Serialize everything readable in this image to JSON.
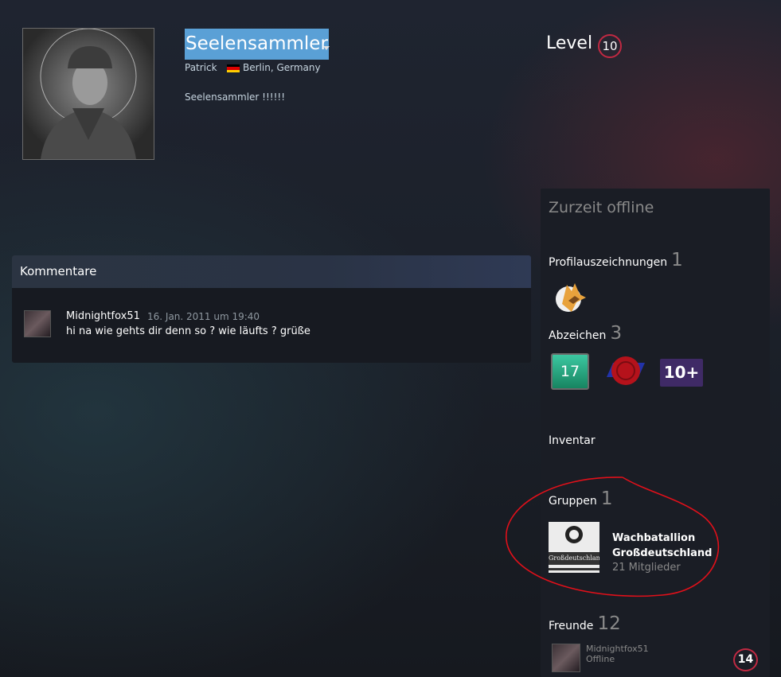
{
  "profile": {
    "persona_name": "Seelensammler",
    "real_name": "Patrick",
    "location": "Berlin, Germany",
    "summary": "Seelensammler !!!!!!",
    "level_label": "Level",
    "level": "10",
    "colors": {
      "level_ring": "#c02942",
      "name_highlight": "#5aa0d6"
    }
  },
  "comments": {
    "title": "Kommentare",
    "items": [
      {
        "author": "Midnightfox51",
        "date": "16. Jan. 2011 um 19:40",
        "text": "hi na wie gehts dir denn so ? wie läufts ? grüße"
      }
    ]
  },
  "sidebar": {
    "status": "Zurzeit offline",
    "awards_label": "Profilauszeichnungen",
    "awards_count": "1",
    "badges_label": "Abzeichen",
    "badges_count": "3",
    "badges": [
      {
        "icon": "badge-17-icon",
        "text": "17"
      },
      {
        "icon": "wax-seal-badge-icon"
      },
      {
        "icon": "badge-10plus-icon",
        "text": "10+"
      }
    ],
    "inventory_label": "Inventar",
    "groups_label": "Gruppen",
    "groups_count": "1",
    "group": {
      "name": "Wachbatallion Großdeutschland",
      "members": "21 Mitglieder",
      "banner_text": "Großdeutschland"
    },
    "friends_label": "Freunde",
    "friends_count": "12",
    "friend": {
      "name": "Midnightfox51",
      "status": "Offline",
      "level": "14"
    }
  }
}
